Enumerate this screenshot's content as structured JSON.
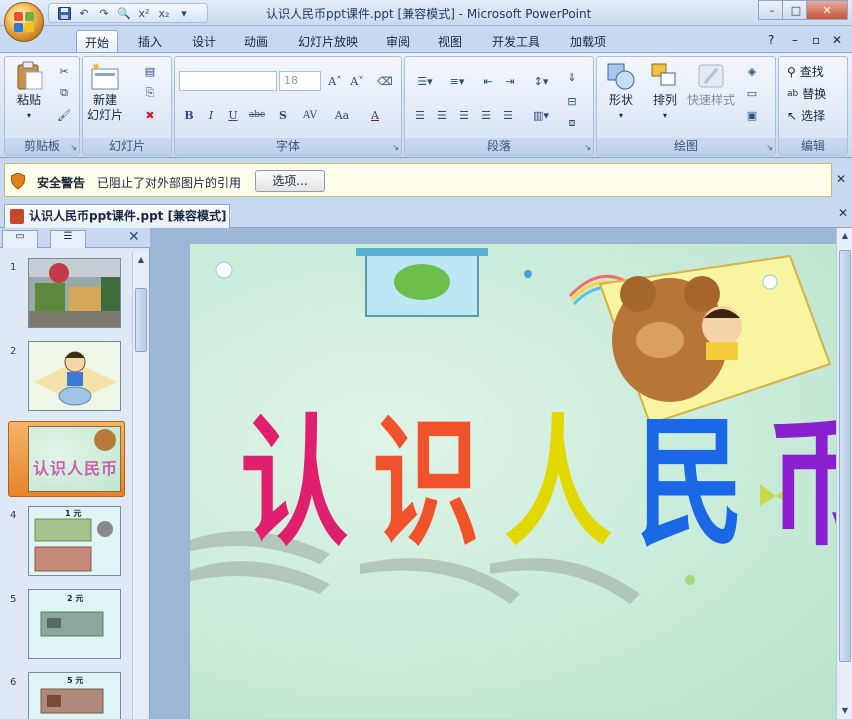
{
  "window": {
    "title": "认识人民币ppt课件.ppt [兼容模式] - Microsoft PowerPoint",
    "minimize": "–",
    "restore": "□",
    "close": "✕"
  },
  "quick_access": {
    "items": [
      "save-icon",
      "undo-icon",
      "redo-icon",
      "print-preview-icon",
      "superscript-icon",
      "subscript-icon",
      "customize-icon"
    ],
    "superscript": "x²",
    "subscript": "x₂"
  },
  "ribbon_tabs": [
    "开始",
    "插入",
    "设计",
    "动画",
    "幻灯片放映",
    "审阅",
    "视图",
    "开发工具",
    "加载项"
  ],
  "ribbon_right": {
    "help": "?",
    "min": "–",
    "restore": "▫",
    "close": "✕"
  },
  "groups": {
    "clipboard": {
      "label": "剪贴板",
      "paste": "粘贴"
    },
    "slides": {
      "label": "幻灯片",
      "new_slide_1": "新建",
      "new_slide_2": "幻灯片"
    },
    "font": {
      "label": "字体",
      "font_name": "",
      "font_size": "18",
      "bold": "B",
      "italic": "I",
      "underline": "U",
      "strike": "abc",
      "shadow": "S",
      "spacing": "AV",
      "case": "Aa",
      "color": "A"
    },
    "paragraph": {
      "label": "段落"
    },
    "drawing": {
      "label": "绘图",
      "shapes": "形状",
      "arrange": "排列",
      "quick_styles": "快速样式"
    },
    "editing": {
      "label": "编辑",
      "find": "查找",
      "replace": "替换",
      "select": "选择"
    }
  },
  "security_bar": {
    "title": "安全警告",
    "message": "已阻止了对外部图片的引用",
    "button": "选项..."
  },
  "document_tab": {
    "label": "认识人民币ppt课件.ppt [兼容模式]"
  },
  "slide_pane": {
    "thumbnails": [
      {
        "number": "1",
        "selected": false,
        "caption": ""
      },
      {
        "number": "2",
        "selected": false,
        "caption": ""
      },
      {
        "number": "3",
        "selected": true,
        "caption": "认识人民币"
      },
      {
        "number": "4",
        "selected": false,
        "caption": "1 元"
      },
      {
        "number": "5",
        "selected": false,
        "caption": "2 元"
      },
      {
        "number": "6",
        "selected": false,
        "caption": "5 元"
      }
    ]
  },
  "slide": {
    "title_chars": [
      "认",
      "识",
      "人",
      "民",
      "币"
    ],
    "title_colors": [
      "#e0206e",
      "#f0532b",
      "#e2d800",
      "#1b68e6",
      "#8a20d0"
    ]
  }
}
